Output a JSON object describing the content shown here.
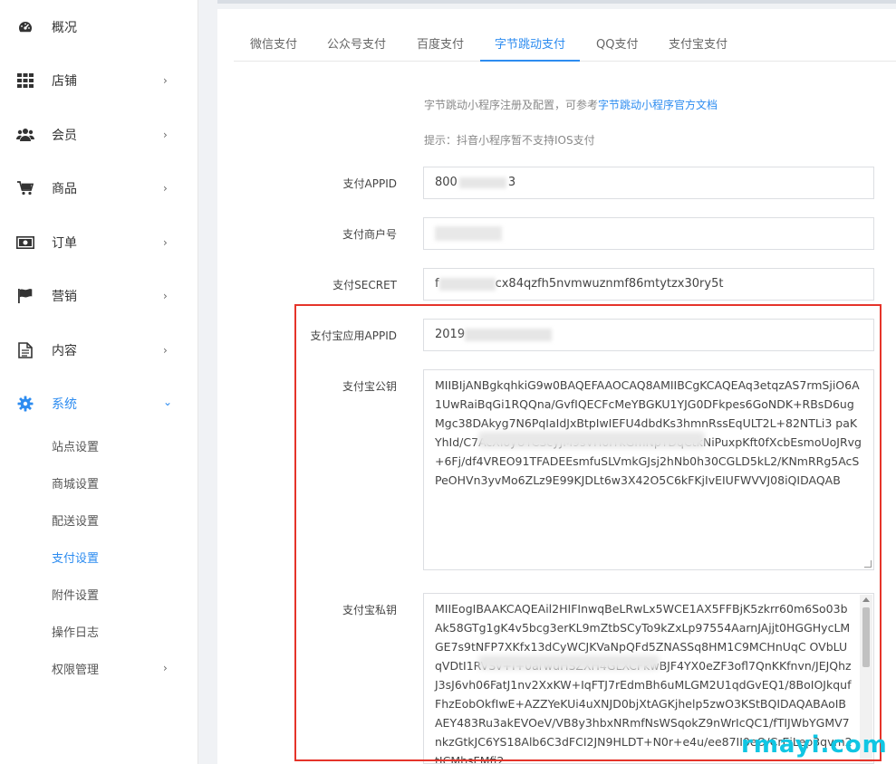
{
  "sidebar": {
    "items": [
      {
        "label": "概况",
        "icon": "dashboard-icon",
        "has_arrow": false
      },
      {
        "label": "店铺",
        "icon": "grid-icon",
        "has_arrow": true
      },
      {
        "label": "会员",
        "icon": "users-icon",
        "has_arrow": true
      },
      {
        "label": "商品",
        "icon": "cart-icon",
        "has_arrow": true
      },
      {
        "label": "订单",
        "icon": "money-icon",
        "has_arrow": true
      },
      {
        "label": "营销",
        "icon": "flag-icon",
        "has_arrow": true
      },
      {
        "label": "内容",
        "icon": "document-icon",
        "has_arrow": true
      },
      {
        "label": "系统",
        "icon": "gear-icon",
        "has_arrow": true,
        "expanded": true
      }
    ],
    "system_sub_items": [
      {
        "label": "站点设置"
      },
      {
        "label": "商城设置"
      },
      {
        "label": "配送设置"
      },
      {
        "label": "支付设置",
        "active": true
      },
      {
        "label": "附件设置"
      },
      {
        "label": "操作日志"
      },
      {
        "label": "权限管理",
        "has_arrow": true
      }
    ],
    "arrow_right": "›",
    "arrow_down": "⌄"
  },
  "tabs": [
    {
      "label": "微信支付"
    },
    {
      "label": "公众号支付"
    },
    {
      "label": "百度支付"
    },
    {
      "label": "字节跳动支付",
      "active": true
    },
    {
      "label": "QQ支付"
    },
    {
      "label": "支付宝支付"
    }
  ],
  "hints": {
    "register_prefix": "字节跳动小程序注册及配置，可参考",
    "register_link": "字节跳动小程序官方文档",
    "ios_note": "提示：抖音小程序暂不支持IOS支付"
  },
  "form": {
    "appid_label": "支付APPID",
    "appid_value_prefix": "800",
    "appid_value_suffix": "3",
    "merchant_label": "支付商户号",
    "secret_label": "支付SECRET",
    "secret_value_prefix": "f",
    "secret_value_suffix": "cx84qzfh5nvmwuznmf86mtytzx30ry5t",
    "alipay_appid_label": "支付宝应用APPID",
    "alipay_appid_value": "2019",
    "alipay_pubkey_label": "支付宝公钥",
    "alipay_pubkey_value": "MIIBIjANBgkqhkiG9w0BAQEFAAOCAQ8AMIIBCgKCAQEAq3etqzAS7rmSjiO6A1UwRaiBqGi1RQQna/GvfIQECFcMeYBGKU1YJG0DFkpes6GoNDK+RBsD6ugMgc38DAkyg7N6PqIaIdJxBtpIwIEFU4dbdKs3hmnRssEqULT2L+82NTLi3                                   paKYhId/C7AcXIoyUTCScyJM9sVHoITkGmNpTDqCtkNiPuxpKft0fXcbEsmoUoJRvg+6Fj/df4VREO91TFADEEsmfuSLVmkGJsj2hNb0h30CGLD5kL2/KNmRRg5AcSPeOHVn3yvMo6ZLz9E99KJDLt6w3X42O5C6kFKjIvEIUFWVVJ08iQIDAQAB",
    "alipay_privkey_label": "支付宝私钥",
    "alipay_privkey_value": "MIIEogIBAAKCAQEAil2HIFInwqBeLRwLx5WCE1AX5FFBjK5zkrr60m6So03bAk58GTg1gK4v5bcg3erKL9mZtbSCyTo9kZxLp97554AarnJAjjt0HGGHycLMGE7s9tNFP7XKfx13dCyWCJKVaNpQFd5ZNASSq8HM1C9MCHnUqC                      OVbLUqVDtI1RVSv+I+0arwuHSZXH4GLXCFkwBJF4YX0eZF3ofl7QnKKfnvn/JEJQhzJ3sJ6vh06FatJ1nv2XxKW+IqFTJ7rEdmBh6uMLGM2U1qdGvEQ1/8BoIOJkqufFhzEobOkfIwE+AZZYeKUi4uXNJD0bjXtAGKjhelp5zwO3KStBQIDAQABAoIBAEY483Ru3akEVOeV/VB8y3hbxNRmfNsWSqokZ9nWrIcQC1/fTIJWbYGMV7nkzGtkJC6YS18Alb6C3dFCI2JN9HLDT+N0r+e4u/ee87II0eO/CrEiLep3qvm2tJCMbsFMfi2"
  },
  "watermark": "rmayi.com"
}
